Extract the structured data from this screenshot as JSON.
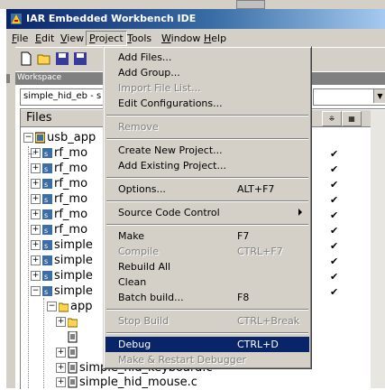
{
  "window": {
    "title": "IAR Embedded Workbench IDE"
  },
  "menubar": [
    {
      "label": "File",
      "key": "F"
    },
    {
      "label": "Edit",
      "key": "E"
    },
    {
      "label": "View",
      "key": "V"
    },
    {
      "label": "Project",
      "key": "P"
    },
    {
      "label": "Tools",
      "key": "T"
    },
    {
      "label": "Window",
      "key": "W"
    },
    {
      "label": "Help",
      "key": "H"
    }
  ],
  "workspace": {
    "header": "Workspace",
    "combo_value": "simple_hid_eb - s",
    "files_header": "Files"
  },
  "tree": {
    "root": "usb_app",
    "rows": [
      "rf_mo",
      "rf_mo",
      "rf_mo",
      "rf_mo",
      "rf_mo",
      "rf_mo",
      "simple",
      "simple",
      "simple",
      "simple"
    ],
    "sub": [
      "app",
      "",
      "",
      "simple_hid_keyboard.c",
      "simple_hid_mouse.c"
    ],
    "checkmark": "✔"
  },
  "project_menu": {
    "items": [
      {
        "label": "Add Files...",
        "shortcut": "",
        "disabled": false
      },
      {
        "label": "Add Group...",
        "shortcut": "",
        "disabled": false
      },
      {
        "label": "Import File List...",
        "shortcut": "",
        "disabled": true
      },
      {
        "label": "Edit Configurations...",
        "shortcut": "",
        "disabled": false
      },
      {
        "label": "Remove",
        "shortcut": "",
        "disabled": true
      },
      {
        "label": "Create New Project...",
        "shortcut": "",
        "disabled": false
      },
      {
        "label": "Add Existing Project...",
        "shortcut": "",
        "disabled": false
      },
      {
        "label": "Options...",
        "shortcut": "ALT+F7",
        "disabled": false
      },
      {
        "label": "Source Code Control",
        "shortcut": "",
        "disabled": false,
        "submenu": true
      },
      {
        "label": "Make",
        "shortcut": "F7",
        "disabled": false
      },
      {
        "label": "Compile",
        "shortcut": "CTRL+F7",
        "disabled": true
      },
      {
        "label": "Rebuild All",
        "shortcut": "",
        "disabled": false
      },
      {
        "label": "Clean",
        "shortcut": "",
        "disabled": false
      },
      {
        "label": "Batch build...",
        "shortcut": "F8",
        "disabled": false
      },
      {
        "label": "Stop Build",
        "shortcut": "CTRL+Break",
        "disabled": true
      },
      {
        "label": "Debug",
        "shortcut": "CTRL+D",
        "disabled": false,
        "highlighted": true
      },
      {
        "label": "Make & Restart Debugger",
        "shortcut": "",
        "disabled": true
      }
    ]
  },
  "colors": {
    "titlebar": "#0a246a",
    "highlight": "#0a246a",
    "face": "#d4d0c8"
  }
}
